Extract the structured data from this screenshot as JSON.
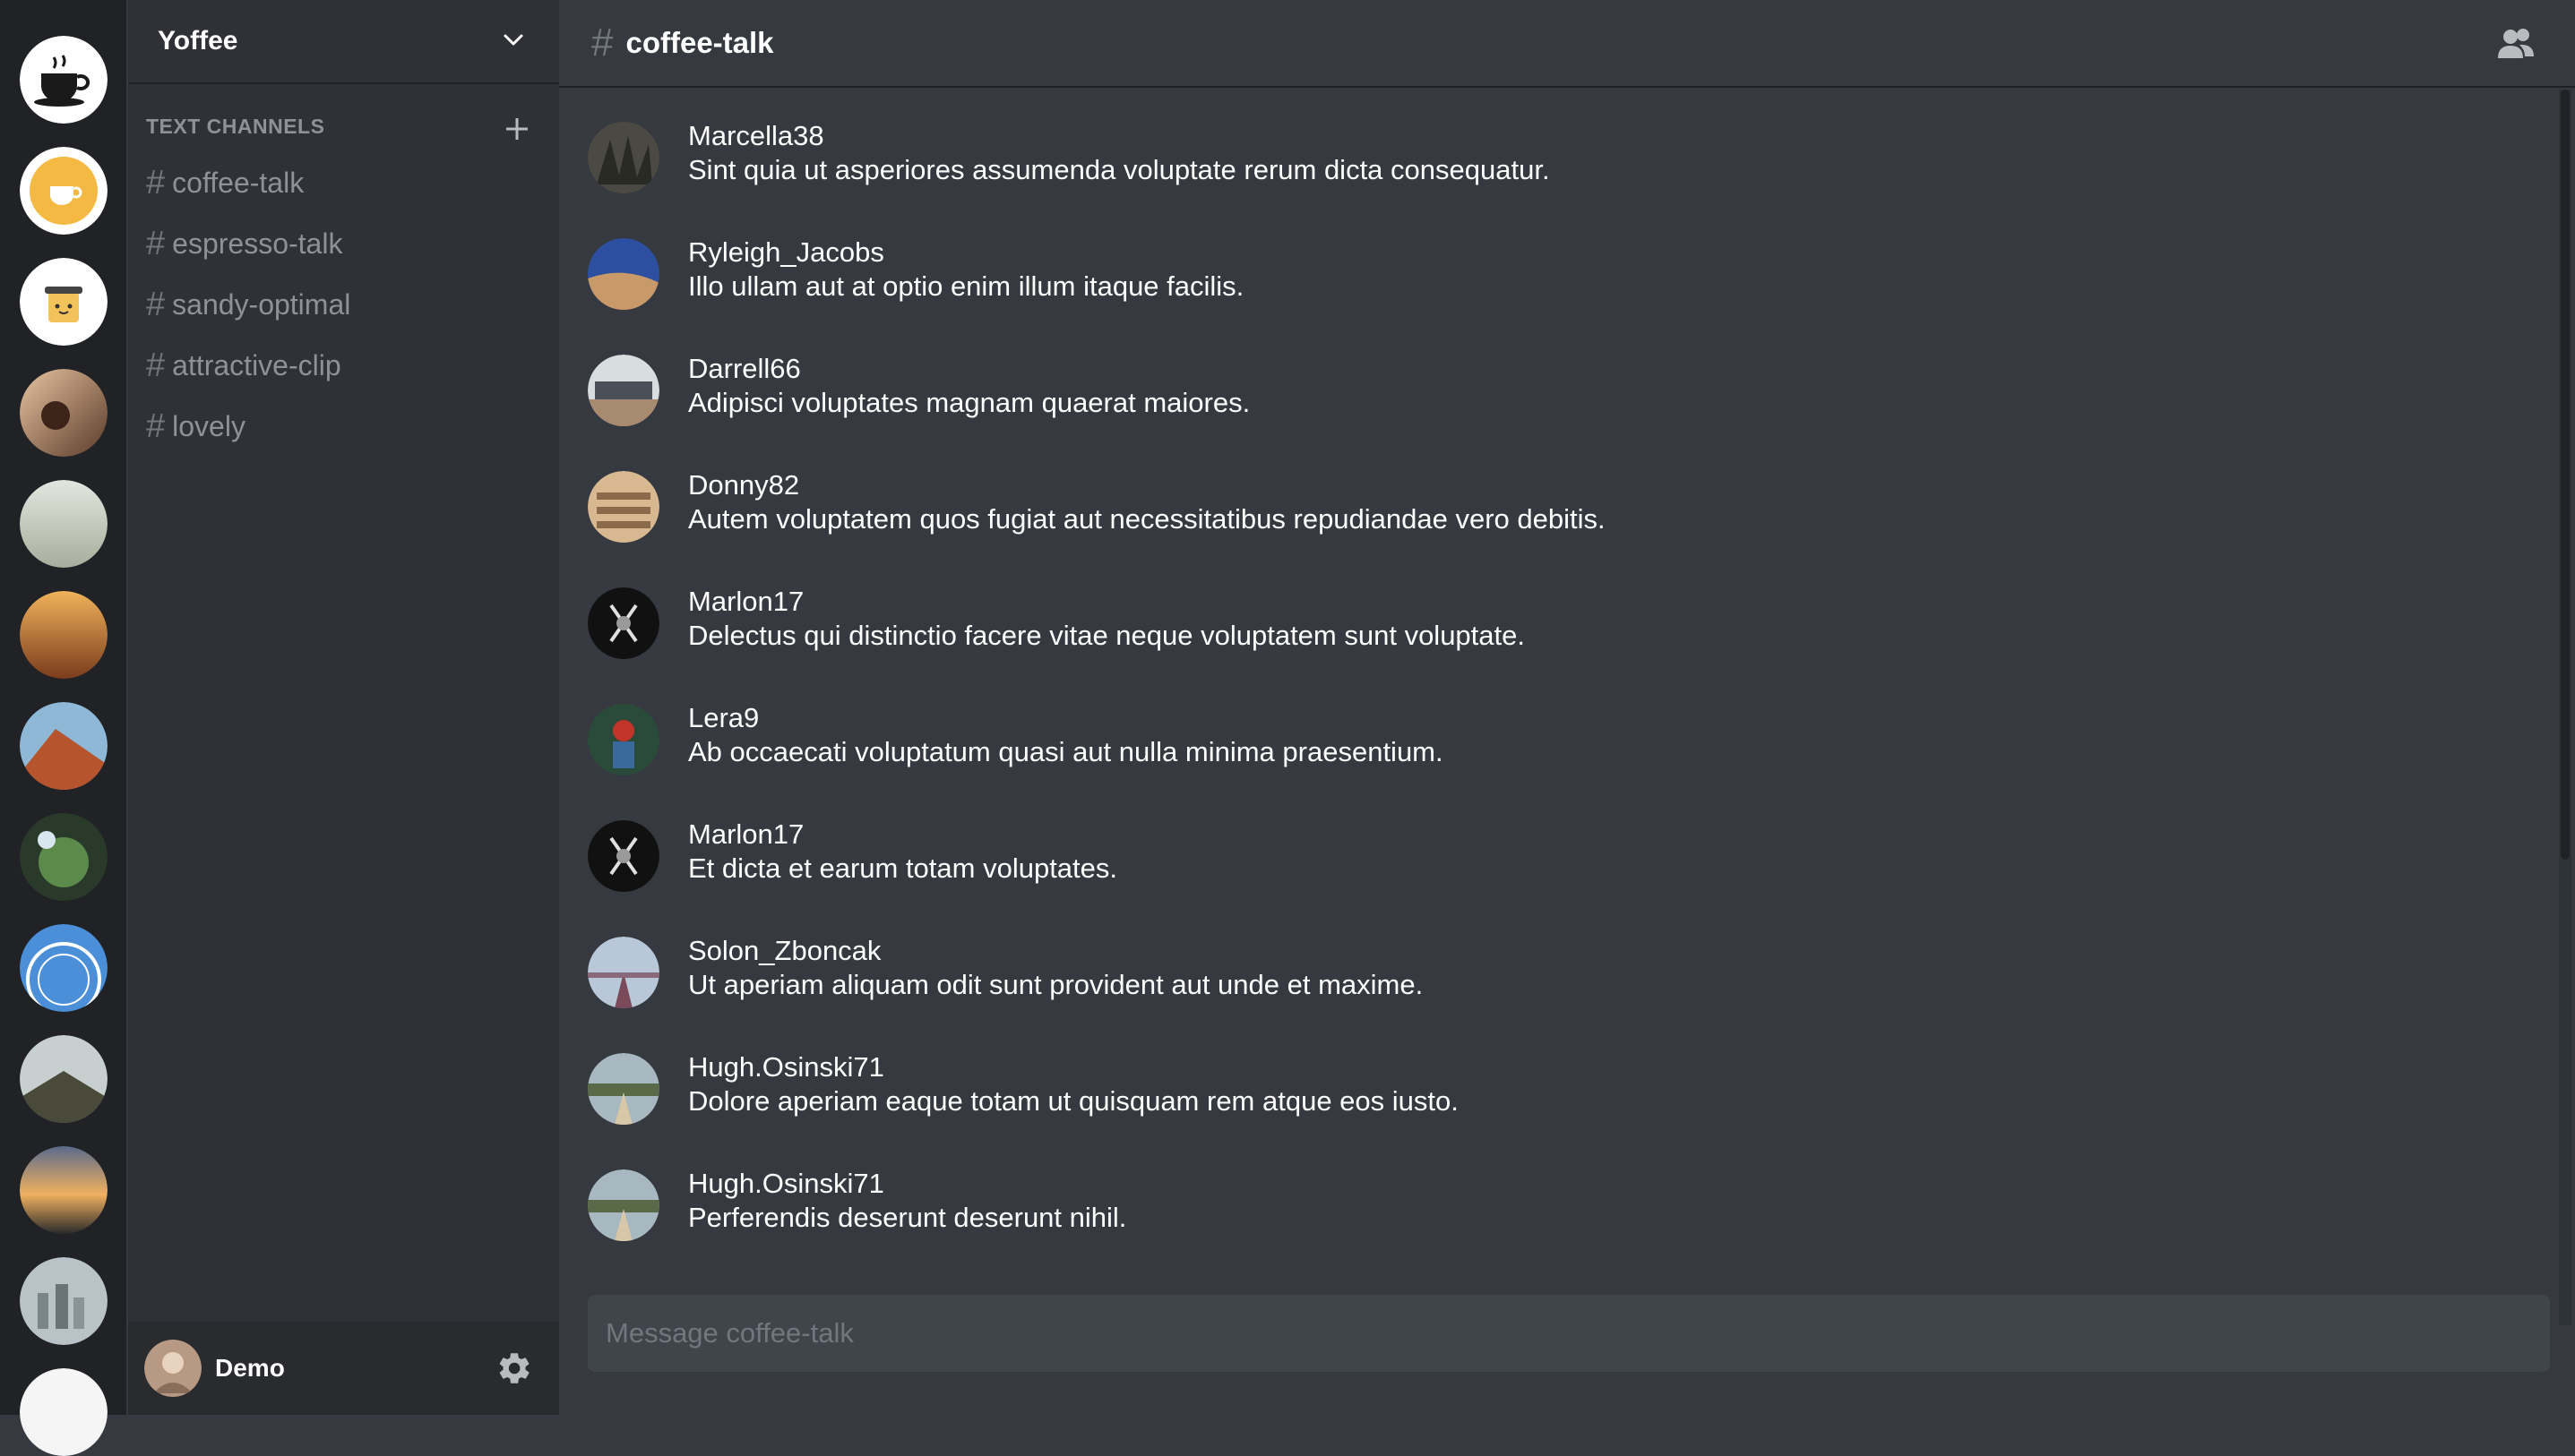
{
  "guild": {
    "name": "Yoffee",
    "chevron_icon": "chevron-down-icon"
  },
  "category": {
    "label": "TEXT CHANNELS",
    "add_icon": "plus-icon"
  },
  "channels": [
    {
      "label": "coffee-talk"
    },
    {
      "label": "espresso-talk"
    },
    {
      "label": "sandy-optimal"
    },
    {
      "label": "attractive-clip"
    },
    {
      "label": "lovely"
    }
  ],
  "hash_symbol": "#",
  "user": {
    "name": "Demo",
    "settings_icon": "gear-icon"
  },
  "channel_header": {
    "title": "coffee-talk",
    "members_icon": "members-icon"
  },
  "messages": [
    {
      "author": "Marcella38",
      "text": "Sint quia ut asperiores assumenda voluptate rerum dicta consequatur."
    },
    {
      "author": "Ryleigh_Jacobs",
      "text": "Illo ullam aut at optio enim illum itaque facilis."
    },
    {
      "author": "Darrell66",
      "text": "Adipisci voluptates magnam quaerat maiores."
    },
    {
      "author": "Donny82",
      "text": "Autem voluptatem quos fugiat aut necessitatibus repudiandae vero debitis."
    },
    {
      "author": "Marlon17",
      "text": "Delectus qui distinctio facere vitae neque voluptatem sunt voluptate."
    },
    {
      "author": "Lera9",
      "text": "Ab occaecati voluptatum quasi aut nulla minima praesentium."
    },
    {
      "author": "Marlon17",
      "text": "Et dicta et earum totam voluptates."
    },
    {
      "author": "Solon_Zboncak",
      "text": "Ut aperiam aliquam odit sunt provident aut unde et maxime."
    },
    {
      "author": "Hugh.Osinski71",
      "text": "Dolore aperiam eaque totam ut quisquam rem atque eos iusto."
    },
    {
      "author": "Hugh.Osinski71",
      "text": "Perferendis deserunt deserunt nihil."
    }
  ],
  "composer": {
    "placeholder": "Message coffee-talk"
  },
  "colors": {
    "rail_bg": "#202225",
    "sidebar_bg": "#2f3136",
    "main_bg": "#36393f",
    "composer_bg": "#40444b",
    "muted_text": "#8e9297"
  }
}
